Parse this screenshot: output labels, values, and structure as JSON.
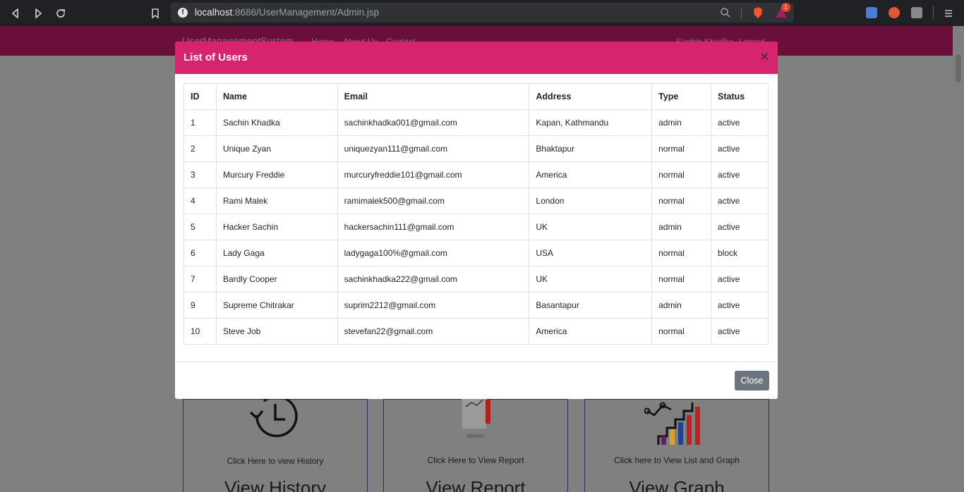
{
  "browser": {
    "url_host": "localhost",
    "url_rest": ":8686/UserManagement/Admin.jsp",
    "notification_count": "1"
  },
  "page": {
    "brand": "UserManagementSystem",
    "links": [
      "Home",
      "About Us",
      "Contact"
    ],
    "user": "Sachin Khadka",
    "logout": "Logout",
    "cards": [
      {
        "caption": "Click Here to view History",
        "title": "View History"
      },
      {
        "caption": "Click Here to View Report",
        "title": "View Report"
      },
      {
        "caption": "Click here to View List and Graph",
        "title": "View Graph"
      }
    ]
  },
  "modal": {
    "title": "List of Users",
    "close_label": "Close",
    "columns": [
      "ID",
      "Name",
      "Email",
      "Address",
      "Type",
      "Status"
    ],
    "rows": [
      [
        "1",
        "Sachin Khadka",
        "sachinkhadka001@gmail.com",
        "Kapan, Kathmandu",
        "admin",
        "active"
      ],
      [
        "2",
        "Unique Zyan",
        "uniquezyan111@gmail.com",
        "Bhaktapur",
        "normal",
        "active"
      ],
      [
        "3",
        "Murcury Freddie",
        "murcuryfreddie101@gmail.com",
        "America",
        "normal",
        "active"
      ],
      [
        "4",
        "Rami Malek",
        "ramimalek500@gmail.com",
        "London",
        "normal",
        "active"
      ],
      [
        "5",
        "Hacker Sachin",
        "hackersachin111@gmail.com",
        "UK",
        "admin",
        "active"
      ],
      [
        "6",
        "Lady Gaga",
        "ladygaga100%@gmail.com",
        "USA",
        "normal",
        "block"
      ],
      [
        "7",
        "Bardly Cooper",
        "sachinkhadka222@gmail.com",
        "UK",
        "normal",
        "active"
      ],
      [
        "9",
        "Supreme Chitrakar",
        "suprim2212@gmail.com",
        "Basantapur",
        "admin",
        "active"
      ],
      [
        "10",
        "Steve Job",
        "stevefan22@gmail.com",
        "America",
        "normal",
        "active"
      ]
    ]
  }
}
